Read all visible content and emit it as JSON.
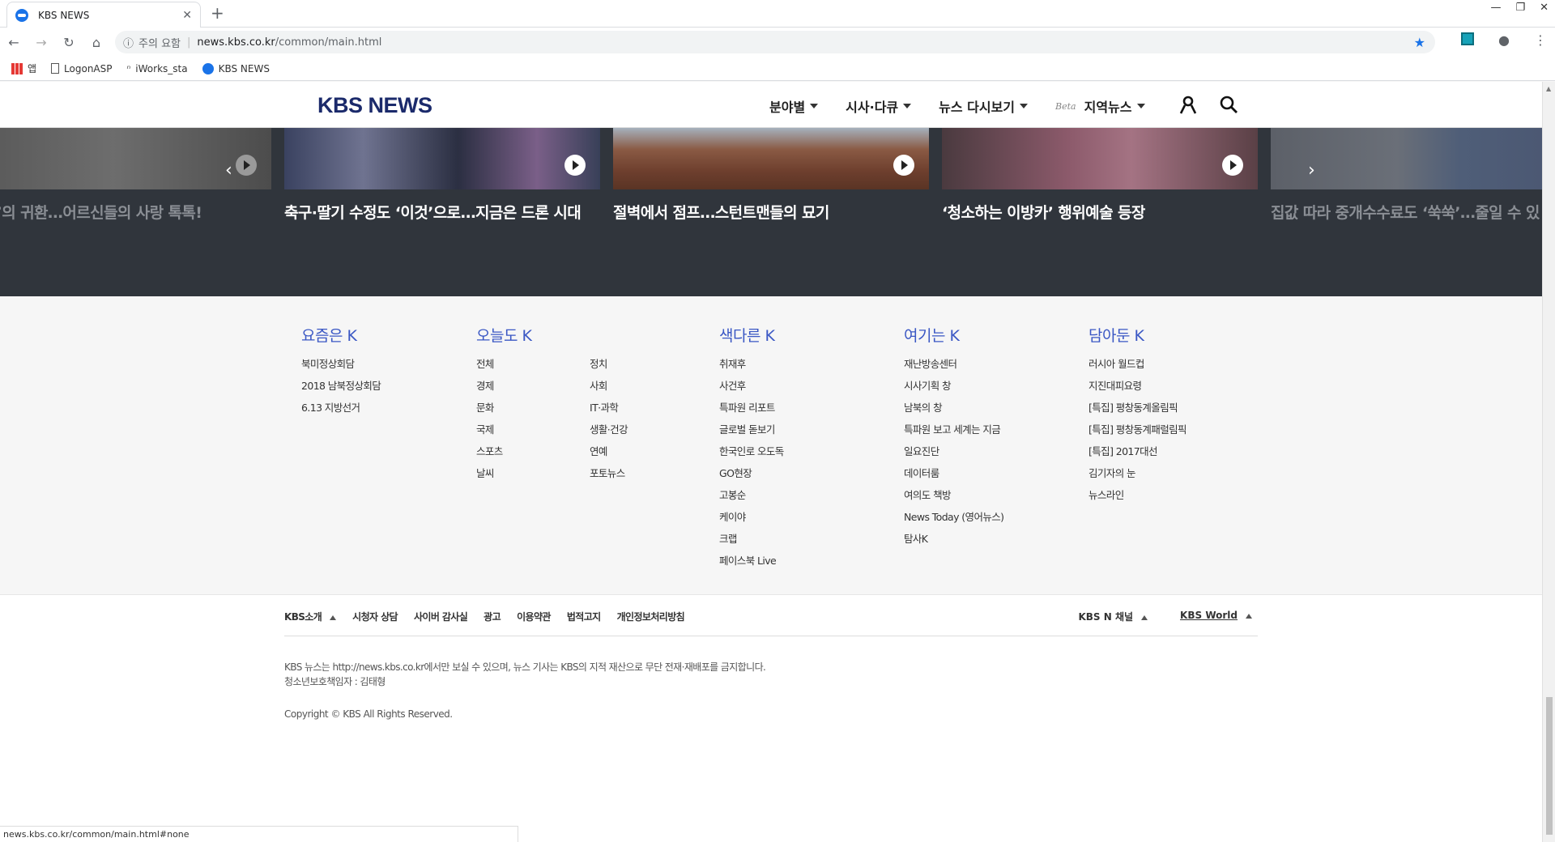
{
  "browser": {
    "tab_title": "KBS NEWS",
    "new_tab": "+",
    "url_warning": "주의 요함",
    "url_host": "news.kbs.co.kr",
    "url_path": "/common/main.html",
    "bookmarks": [
      "앱",
      "LogonASP",
      "iWorks_sta",
      "KBS NEWS"
    ],
    "status_url": "news.kbs.co.kr/common/main.html#none"
  },
  "header": {
    "logo": "KBS NEWS",
    "menu": [
      "분야별",
      "시사·다큐",
      "뉴스 다시보기",
      "지역뉴스"
    ],
    "beta": "Beta"
  },
  "carousel": {
    "items": [
      "안내원’의 귀환…어르신들의 사랑 톡톡!",
      "축구·딸기 수정도 ‘이것’으로…지금은 드론 시대",
      "절벽에서 점프…스턴트맨들의 묘기",
      "‘청소하는 이방카’ 행위예술 등장",
      "집값 따라 중개수수료도 ‘쑥쑥’…줄일 수 있"
    ]
  },
  "footer_cats": {
    "yojeum": {
      "title": "요즘은 K",
      "items": [
        "북미정상회담",
        "2018 남북정상회담",
        "6.13 지방선거"
      ]
    },
    "oneul": {
      "title": "오늘도 K",
      "items": [
        "전체",
        "정치",
        "경제",
        "사회",
        "문화",
        "IT·과학",
        "국제",
        "생활·건강",
        "스포츠",
        "연예",
        "날씨",
        "포토뉴스"
      ]
    },
    "saekdareun": {
      "title": "색다른 K",
      "items": [
        "취재후",
        "사건후",
        "특파원 리포트",
        "글로벌 돋보기",
        "한국인로 오도독",
        "GO현장",
        "고봉순",
        "케이야",
        "크랩",
        "페이스북 Live"
      ]
    },
    "yeogineun": {
      "title": "여기는 K",
      "items": [
        "재난방송센터",
        "시사기획 창",
        "남북의 창",
        "특파원 보고 세계는 지금",
        "일요진단",
        "데이터룸",
        "여의도 책방",
        "News Today (영어뉴스)",
        "탐사K"
      ]
    },
    "damadun": {
      "title": "담아둔 K",
      "items": [
        "러시아 월드컵",
        "지진대피요령",
        "[특집] 평창동계올림픽",
        "[특집] 평창동계패럴림픽",
        "[특집] 2017대선",
        "김기자의 눈",
        "뉴스라인"
      ]
    }
  },
  "footer": {
    "links": [
      "KBS소개",
      "시청자 상담",
      "사이버 감사실",
      "광고",
      "이용약관",
      "법적고지",
      "개인정보처리방침"
    ],
    "kbsn": "KBS N 채널",
    "world": "KBS World",
    "notice1": "KBS 뉴스는 http://news.kbs.co.kr에서만 보실 수 있으며, 뉴스 기사는 KBS의 지적 재산으로 무단 전재·재배포를 금지합니다.",
    "notice2": "청소년보호책임자 : 김태형",
    "copyright": "Copyright © KBS All Rights Reserved."
  }
}
